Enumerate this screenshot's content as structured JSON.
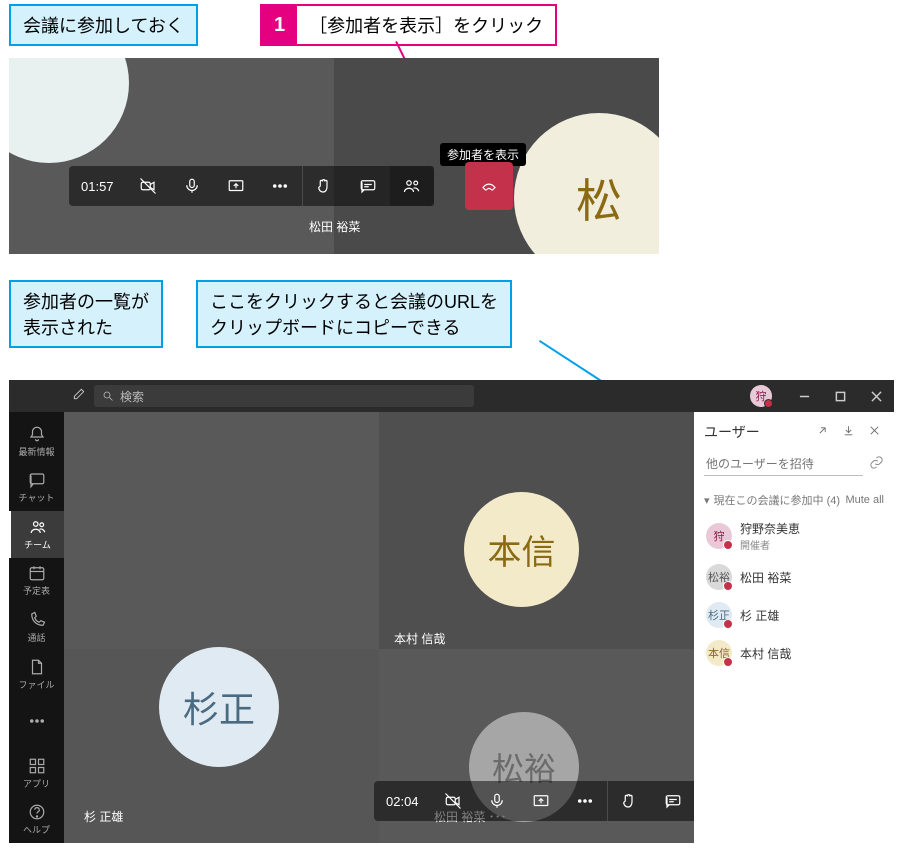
{
  "annotations": {
    "pre": "会議に参加しておく",
    "step1_num": "1",
    "step1_text": "［参加者を表示］をクリック",
    "result": "参加者の一覧が\n表示された",
    "hint": "ここをクリックすると会議のURLを\nクリップボードにコピーできる"
  },
  "panel1": {
    "tooltip": "参加者を表示",
    "avatar_right_initials": "松",
    "time": "01:57",
    "caption": "松田 裕菜"
  },
  "search_placeholder": "検索",
  "profile_initial": "狩",
  "rail": [
    {
      "icon": "bell",
      "label": "最新情報"
    },
    {
      "icon": "chat",
      "label": "チャット"
    },
    {
      "icon": "team",
      "label": "チーム"
    },
    {
      "icon": "cal",
      "label": "予定表"
    },
    {
      "icon": "phone",
      "label": "通話"
    },
    {
      "icon": "file",
      "label": "ファイル"
    },
    {
      "icon": "dots",
      "label": ""
    }
  ],
  "rail_bottom": [
    {
      "icon": "apps",
      "label": "アプリ"
    },
    {
      "icon": "help",
      "label": "ヘルプ"
    }
  ],
  "stage": {
    "av1": "杉正",
    "av2": "本信",
    "av3": "松裕",
    "cap1": "杉 正雄",
    "cap2": "本村 信哉",
    "cap3": "松田 裕菜 ･･･",
    "time": "02:04"
  },
  "users": {
    "title": "ユーザー",
    "invite_placeholder": "他のユーザーを招待",
    "section": "現在この会議に参加中 (4)",
    "mute_all": "Mute all",
    "list": [
      {
        "initials": "狩",
        "name": "狩野奈美恵",
        "role": "開催者",
        "bg": "#e9c9d8",
        "fg": "#8a1a4a"
      },
      {
        "initials": "松裕",
        "name": "松田 裕菜",
        "role": "",
        "bg": "#d9d9d9",
        "fg": "#555"
      },
      {
        "initials": "杉正",
        "name": "杉 正雄",
        "role": "",
        "bg": "#dfeaf2",
        "fg": "#4a6a82"
      },
      {
        "initials": "本信",
        "name": "本村 信哉",
        "role": "",
        "bg": "#f2eac8",
        "fg": "#8a6b14"
      }
    ]
  }
}
